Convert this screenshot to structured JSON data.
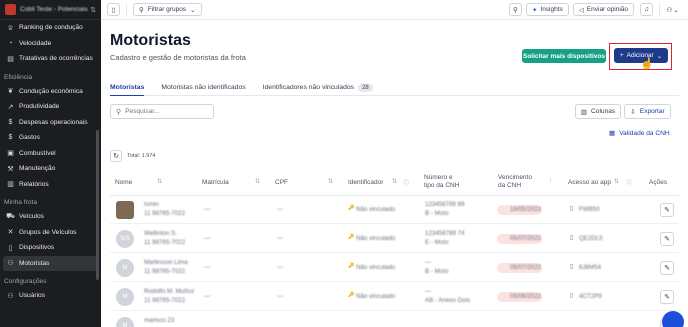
{
  "sidebar": {
    "org_name": "Cobli Teste - Potenciais",
    "items_top": [
      {
        "label": "Ranking de condução",
        "icon": "trophy-icon",
        "glyph": "♕"
      },
      {
        "label": "Velocidade",
        "icon": "speedometer-icon",
        "glyph": "◔"
      },
      {
        "label": "Tratativas de ocorrências",
        "icon": "clipboard-icon",
        "glyph": "▤"
      }
    ],
    "section_efficiency": "Eficiência",
    "items_efficiency": [
      {
        "label": "Condução econômica",
        "icon": "leaf-icon",
        "glyph": "❦"
      },
      {
        "label": "Produtividade",
        "icon": "trend-icon",
        "glyph": "↗"
      },
      {
        "label": "Despesas operacionais",
        "icon": "dollar-icon",
        "glyph": "$"
      },
      {
        "label": "Gastos",
        "icon": "dollar-icon",
        "glyph": "$"
      },
      {
        "label": "Combustível",
        "icon": "fuel-icon",
        "glyph": "▣"
      },
      {
        "label": "Manutenção",
        "icon": "wrench-icon",
        "glyph": "⚒"
      },
      {
        "label": "Relatórios",
        "icon": "chart-icon",
        "glyph": "▥"
      }
    ],
    "section_fleet": "Minha frota",
    "items_fleet": [
      {
        "label": "Veículos",
        "icon": "car-icon",
        "glyph": "⛟"
      },
      {
        "label": "Grupos de Veículos",
        "icon": "group-icon",
        "glyph": "✕"
      },
      {
        "label": "Dispositivos",
        "icon": "device-icon",
        "glyph": "▯"
      },
      {
        "label": "Motoristas",
        "icon": "users-icon",
        "glyph": "⚇"
      }
    ],
    "section_config": "Configurações",
    "items_config": [
      {
        "label": "Usuários",
        "icon": "user-icon",
        "glyph": "⚇"
      }
    ]
  },
  "topbar": {
    "filter_label": "Filtrar grupos",
    "insights_label": "Insights",
    "feedback_label": "Enviar opinião"
  },
  "page": {
    "title": "Motoristas",
    "subtitle": "Cadastro e gestão de motoristas da frota",
    "more_devices_label": "Solicitar mais dispositivos",
    "add_label": "Adicionar"
  },
  "tabs": [
    {
      "label": "Motoristas"
    },
    {
      "label": "Motoristas não identificados"
    },
    {
      "label": "Identificadores não vinculados",
      "badge": "28"
    }
  ],
  "toolbar": {
    "search_placeholder": "Pesquisar...",
    "columns_label": "Colunas",
    "export_label": "Exportar",
    "validity_label": "Validade da CNH",
    "total_label": "Total: 1.974"
  },
  "table": {
    "headers": {
      "name": "Nome",
      "registration": "Matrícula",
      "cpf": "CPF",
      "identifier": "Identificador",
      "cnh_number": "Número e tipo da CNH",
      "cnh_expiry": "Vencimento da CNH",
      "app_access": "Acesso ao app",
      "actions": "Ações"
    },
    "rows": [
      {
        "initials": "",
        "name": "Ismin",
        "phone": "11 98765-7022",
        "reg": "—",
        "cpf": "—",
        "ident": "Não vinculado",
        "cnh": "123456789 89",
        "cnh_type": "B - Moto",
        "expiry": "18/05/2023",
        "app": "FWB50",
        "photo": true
      },
      {
        "initials": "WS",
        "name": "Wellinton S.",
        "phone": "11 98765-7022",
        "reg": "—",
        "cpf": "—",
        "ident": "Não vinculado",
        "cnh": "123456789 74",
        "cnh_type": "E - Moto",
        "expiry": "05/07/2022",
        "app": "QE2DL5",
        "photo": false
      },
      {
        "initials": "M",
        "name": "Marlesson Lima",
        "phone": "11 98765-7022",
        "reg": "—",
        "cpf": "—",
        "ident": "Não vinculado",
        "cnh": "—",
        "cnh_type": "B - Moto",
        "expiry": "05/07/2022",
        "app": "6J8M54",
        "photo": false
      },
      {
        "initials": "M",
        "name": "Rodolfo M. Muñoz",
        "phone": "11 98765-7022",
        "reg": "—",
        "cpf": "—",
        "ident": "Não vinculado",
        "cnh": "—",
        "cnh_type": "AB - Anexo Dois",
        "expiry": "05/06/2022",
        "app": "4CT2P9",
        "photo": false
      },
      {
        "initials": "M",
        "name": "marisco 23",
        "phone": "",
        "reg": "",
        "cpf": "",
        "ident": "",
        "cnh": "",
        "cnh_type": "",
        "expiry": "",
        "app": "",
        "photo": false
      }
    ]
  },
  "colors": {
    "sidebar_bg": "#1c1d21",
    "primary": "#1e3a8a",
    "green": "#16a085",
    "highlight": "#e02424"
  }
}
